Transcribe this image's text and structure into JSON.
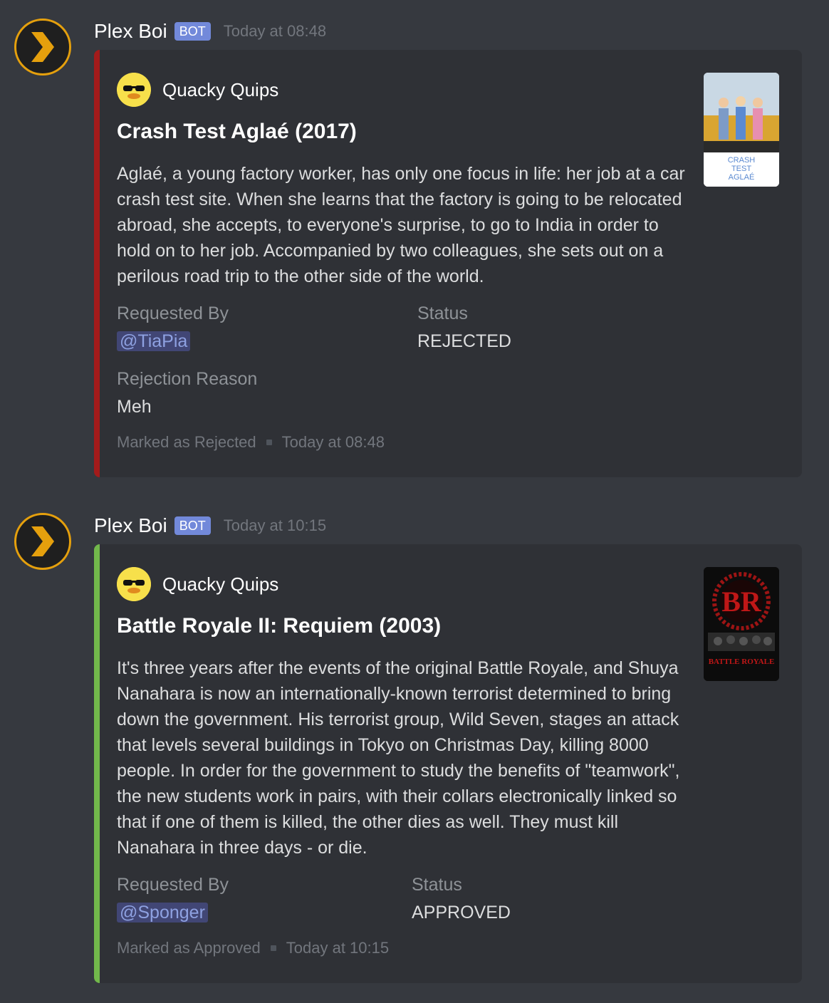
{
  "messages": [
    {
      "author": "Plex Boi",
      "bot_tag": "BOT",
      "timestamp": "Today at 08:48",
      "embed": {
        "author_name": "Quacky Quips",
        "title": "Crash Test Aglaé (2017)",
        "description": "Aglaé, a young factory worker, has only one focus in life: her job at a car crash test site. When she learns that the factory is going to be relocated abroad, she accepts, to everyone's surprise, to go to India in order to hold on to her job. Accompanied by two colleagues, she sets out on a perilous road trip to the other side of the world.",
        "requested_by_label": "Requested By",
        "requested_by_value": "@TiaPia",
        "status_label": "Status",
        "status_value": "REJECTED",
        "reason_label": "Rejection Reason",
        "reason_value": "Meh",
        "footer_text": "Marked as Rejected",
        "footer_time": "Today at 08:48",
        "poster_text": "CRASH TEST AGLAÉ",
        "accent": "#a31b1b"
      }
    },
    {
      "author": "Plex Boi",
      "bot_tag": "BOT",
      "timestamp": "Today at 10:15",
      "embed": {
        "author_name": "Quacky Quips",
        "title": "Battle Royale II: Requiem (2003)",
        "description": "It's three years after the events of the original Battle Royale, and Shuya Nanahara is now an internationally-known terrorist determined to bring down the government. His terrorist group, Wild Seven, stages an attack that levels several buildings in Tokyo on Christmas Day, killing 8000 people. In order for the government to study the benefits of \"teamwork\", the new students work in pairs, with their collars electronically linked so that if one of them is killed, the other dies as well. They must kill Nanahara in three days - or die.",
        "requested_by_label": "Requested By",
        "requested_by_value": "@Sponger",
        "status_label": "Status",
        "status_value": "APPROVED",
        "footer_text": "Marked as Approved",
        "footer_time": "Today at 10:15",
        "poster_logo": "BR",
        "poster_text": "BATTLE ROYALE",
        "accent": "#72b84b"
      }
    }
  ]
}
